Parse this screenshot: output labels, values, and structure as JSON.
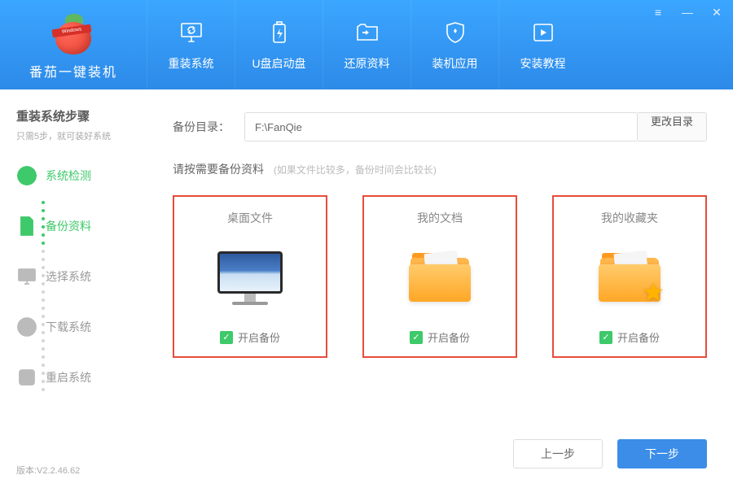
{
  "brand": {
    "title": "番茄一键装机",
    "band": "Windows"
  },
  "nav": [
    {
      "label": "重装系统"
    },
    {
      "label": "U盘启动盘"
    },
    {
      "label": "还原资料"
    },
    {
      "label": "装机应用"
    },
    {
      "label": "安装教程"
    }
  ],
  "sidebar": {
    "title": "重装系统步骤",
    "subtitle": "只需5步，就可装好系统",
    "steps": [
      {
        "label": "系统检测"
      },
      {
        "label": "备份资料"
      },
      {
        "label": "选择系统"
      },
      {
        "label": "下载系统"
      },
      {
        "label": "重启系统"
      }
    ],
    "version": "版本:V2.2.46.62"
  },
  "main": {
    "path_label": "备份目录：",
    "path_value": "F:\\FanQie",
    "change_dir": "更改目录",
    "prompt": "请按需要备份资料",
    "prompt_hint": "(如果文件比较多，备份时间会比较长)",
    "cards": [
      {
        "title": "桌面文件",
        "check": "开启备份"
      },
      {
        "title": "我的文档",
        "check": "开启备份"
      },
      {
        "title": "我的收藏夹",
        "check": "开启备份"
      }
    ],
    "prev": "上一步",
    "next": "下一步"
  }
}
